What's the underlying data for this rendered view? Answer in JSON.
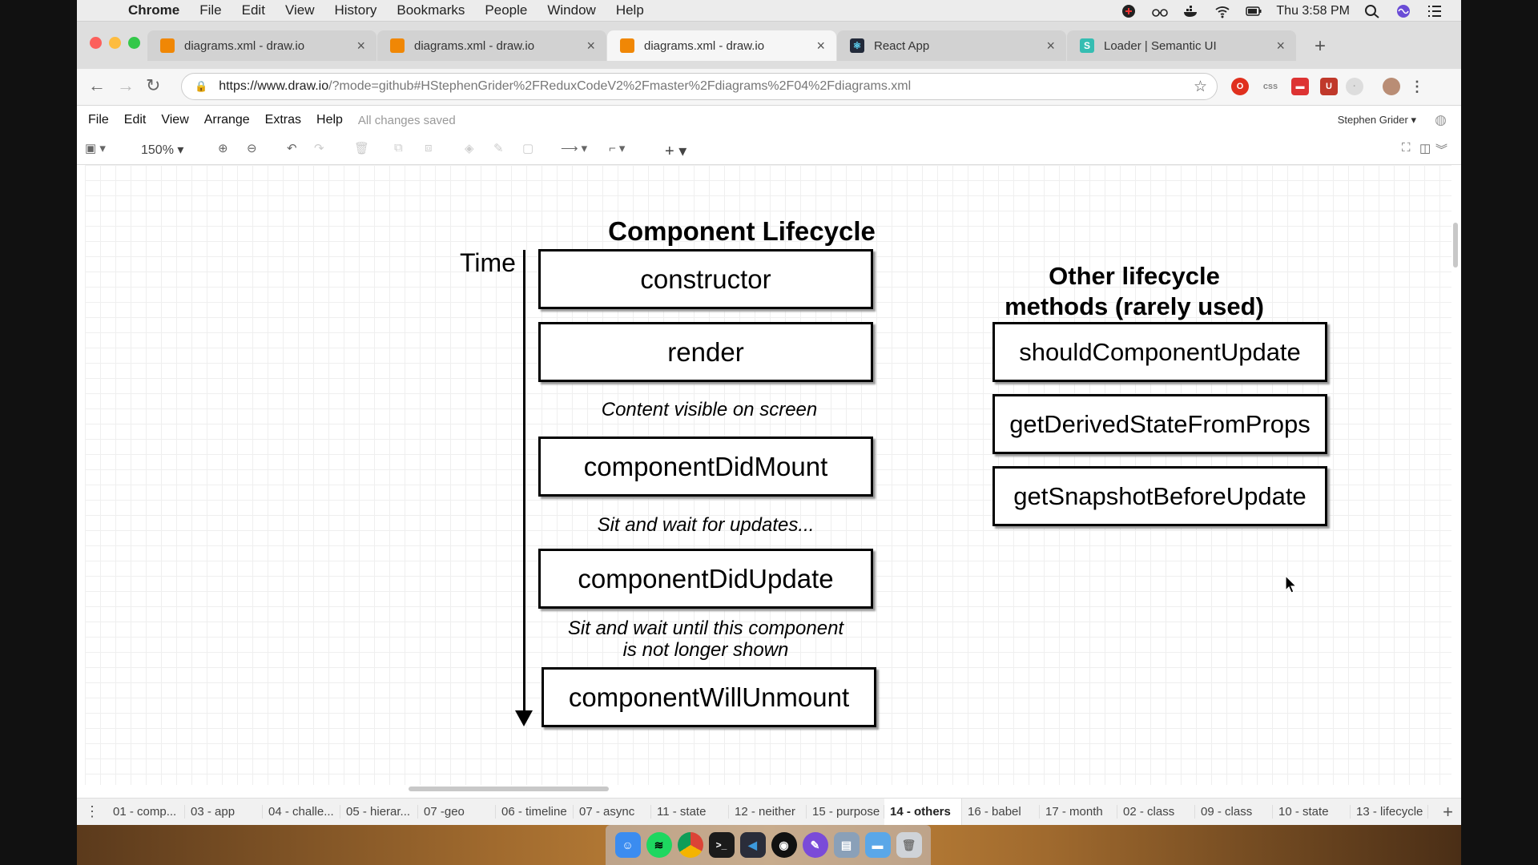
{
  "menubar": {
    "app": "Chrome",
    "items": [
      "File",
      "Edit",
      "View",
      "History",
      "Bookmarks",
      "People",
      "Window",
      "Help"
    ],
    "clock": "Thu 3:58 PM"
  },
  "tabs": [
    {
      "title": "diagrams.xml - draw.io",
      "favicon_color": "#f08705",
      "active": false
    },
    {
      "title": "diagrams.xml - draw.io",
      "favicon_color": "#f08705",
      "active": false
    },
    {
      "title": "diagrams.xml - draw.io",
      "favicon_color": "#f08705",
      "active": true
    },
    {
      "title": "React App",
      "favicon_color": "#222a3a",
      "active": false
    },
    {
      "title": "Loader | Semantic UI",
      "favicon_color": "#35bdb2",
      "active": false
    }
  ],
  "address": {
    "host": "https://www.draw.io",
    "path": "/?mode=github#HStephenGrider%2FReduxCodeV2%2Fmaster%2Fdiagrams%2F04%2Fdiagrams.xml"
  },
  "appmenu": {
    "items": [
      "File",
      "Edit",
      "View",
      "Arrange",
      "Extras",
      "Help"
    ],
    "status": "All changes saved",
    "user": "Stephen Grider"
  },
  "toolbar": {
    "zoom": "150%"
  },
  "diagram": {
    "title": "Component Lifecycle",
    "time_label": "Time",
    "boxes": [
      "constructor",
      "render",
      "componentDidMount",
      "componentDidUpdate",
      "componentWillUnmount"
    ],
    "notes": [
      "Content visible on screen",
      "Sit and wait for updates...",
      "Sit and wait until this component",
      "is not longer shown"
    ],
    "other_title_line1": "Other lifecycle",
    "other_title_line2": "methods (rarely used)",
    "other_boxes": [
      "shouldComponentUpdate",
      "getDerivedStateFromProps",
      "getSnapshotBeforeUpdate"
    ]
  },
  "pages": [
    "01 - comp...",
    "03 - app",
    "04 - challe...",
    "05 - hierar...",
    "07 -geo",
    "06 - timeline",
    "07 - async",
    "11 - state",
    "12 - neither",
    "15 - purpose",
    "14 - others",
    "16 - babel",
    "17 - month",
    "02 - class",
    "09 - class",
    "10 - state",
    "13 - lifecycle"
  ],
  "active_page": "14 - others",
  "colors": {
    "close": "#fc605c",
    "minimize": "#fdbc40",
    "maximize": "#34c84a"
  }
}
